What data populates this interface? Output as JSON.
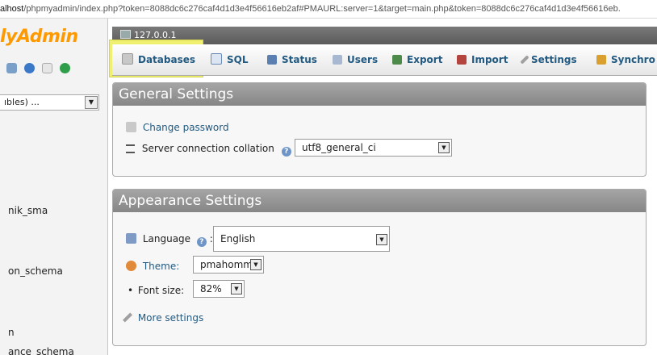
{
  "urlbar": {
    "host": "alhost",
    "path": "/phpmyadmin/index.php?token=8088dc6c276caf4d1d3e4f56616eb2af#PMAURL:server=1&target=main.php&token=8088dc6c276caf4d1d3e4f56616eb."
  },
  "sidebar": {
    "logo": "lyAdmin",
    "db_select": "ıbles) ...",
    "items": [
      "nik_sma",
      "on_schema",
      "n",
      "ance_schema"
    ]
  },
  "server": {
    "label": "127.0.0.1"
  },
  "tabs": [
    {
      "label": "Databases"
    },
    {
      "label": "SQL"
    },
    {
      "label": "Status"
    },
    {
      "label": "Users"
    },
    {
      "label": "Export"
    },
    {
      "label": "Import"
    },
    {
      "label": "Settings"
    },
    {
      "label": "Synchro"
    }
  ],
  "general": {
    "title": "General Settings",
    "change_password": "Change password",
    "collation_label": "Server connection collation",
    "collation_sep": ":",
    "collation_value": "utf8_general_ci"
  },
  "appearance": {
    "title": "Appearance Settings",
    "language_label": "Language",
    "language_sep": ":",
    "language_value": "English",
    "theme_label": "Theme:",
    "theme_value": "pmahomme",
    "font_label": "Font size:",
    "font_value": "82%",
    "more": "More settings"
  }
}
